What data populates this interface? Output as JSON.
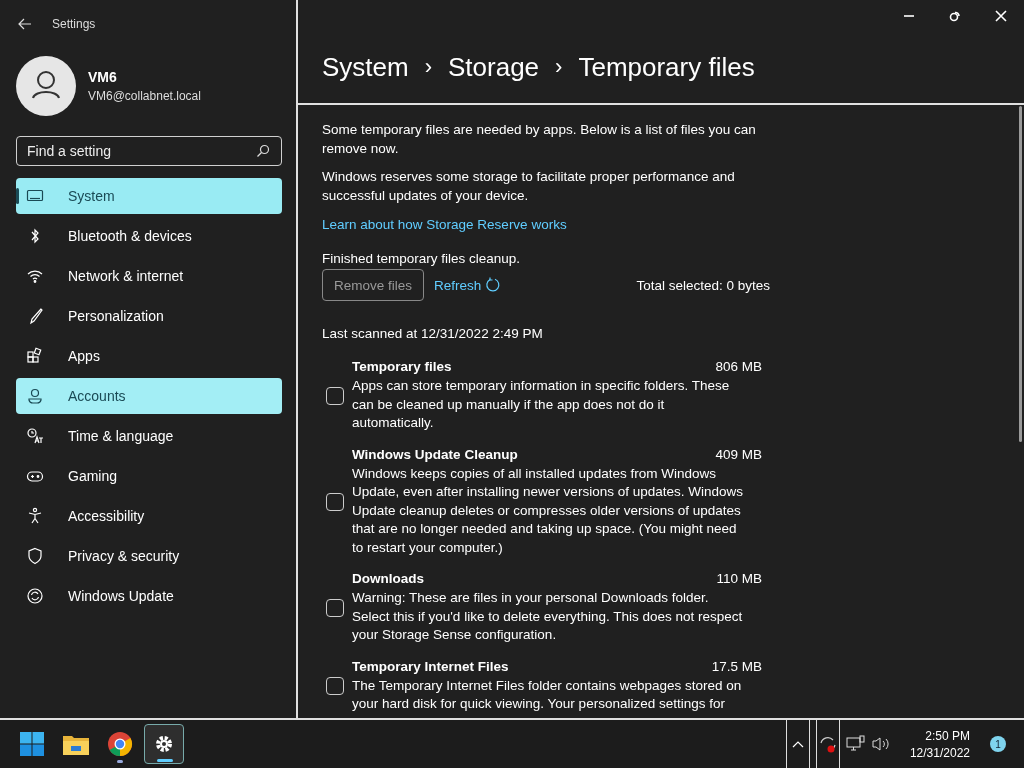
{
  "window": {
    "title": "Settings"
  },
  "user": {
    "name": "VM6",
    "email": "VM6@collabnet.local"
  },
  "search": {
    "placeholder": "Find a setting"
  },
  "nav": [
    {
      "label": "System",
      "selected": true,
      "hovered": false
    },
    {
      "label": "Bluetooth & devices",
      "selected": false,
      "hovered": false
    },
    {
      "label": "Network & internet",
      "selected": false,
      "hovered": false
    },
    {
      "label": "Personalization",
      "selected": false,
      "hovered": false
    },
    {
      "label": "Apps",
      "selected": false,
      "hovered": false
    },
    {
      "label": "Accounts",
      "selected": false,
      "hovered": true
    },
    {
      "label": "Time & language",
      "selected": false,
      "hovered": false
    },
    {
      "label": "Gaming",
      "selected": false,
      "hovered": false
    },
    {
      "label": "Accessibility",
      "selected": false,
      "hovered": false
    },
    {
      "label": "Privacy & security",
      "selected": false,
      "hovered": false
    },
    {
      "label": "Windows Update",
      "selected": false,
      "hovered": false
    }
  ],
  "breadcrumb": [
    "System",
    "Storage",
    "Temporary files"
  ],
  "breadcrumb_separator": "›",
  "intro": [
    "Some temporary files are needed by apps. Below is a list of files you can remove now.",
    "Windows reserves some storage to facilitate proper performance and successful updates of your device."
  ],
  "link": "Learn about how Storage Reserve works",
  "status": "Finished temporary files cleanup.",
  "remove_button": {
    "label": "Remove files",
    "disabled": true
  },
  "refresh_link": "Refresh",
  "total_selected": "Total selected: 0 bytes",
  "last_scanned": "Last scanned at 12/31/2022 2:49 PM",
  "files": [
    {
      "title": "Temporary files",
      "size": "806 MB",
      "checked": false,
      "description": "Apps can store temporary information in specific folders. These can be cleaned up manually if the app does not do it automatically."
    },
    {
      "title": "Windows Update Cleanup",
      "size": "409 MB",
      "checked": false,
      "description": "Windows keeps copies of all installed updates from Windows Update, even after installing newer versions of updates. Windows Update cleanup deletes or compresses older versions of updates that are no longer needed and taking up space. (You might need to restart your computer.)"
    },
    {
      "title": "Downloads",
      "size": "110 MB",
      "checked": false,
      "description": "Warning: These are files in your personal Downloads folder. Select this if you'd like to delete everything. This does not respect your Storage Sense configuration."
    },
    {
      "title": "Temporary Internet Files",
      "size": "17.5 MB",
      "checked": false,
      "description": "The Temporary Internet Files folder contains webpages stored on your hard disk for quick viewing. Your personalized settings for"
    }
  ],
  "taskbar": {
    "apps": [
      {
        "active": false
      },
      {
        "active": false
      },
      {
        "active": false
      },
      {
        "active": true
      }
    ],
    "time": "2:50 PM",
    "date": "12/31/2022",
    "notifications": "1"
  }
}
